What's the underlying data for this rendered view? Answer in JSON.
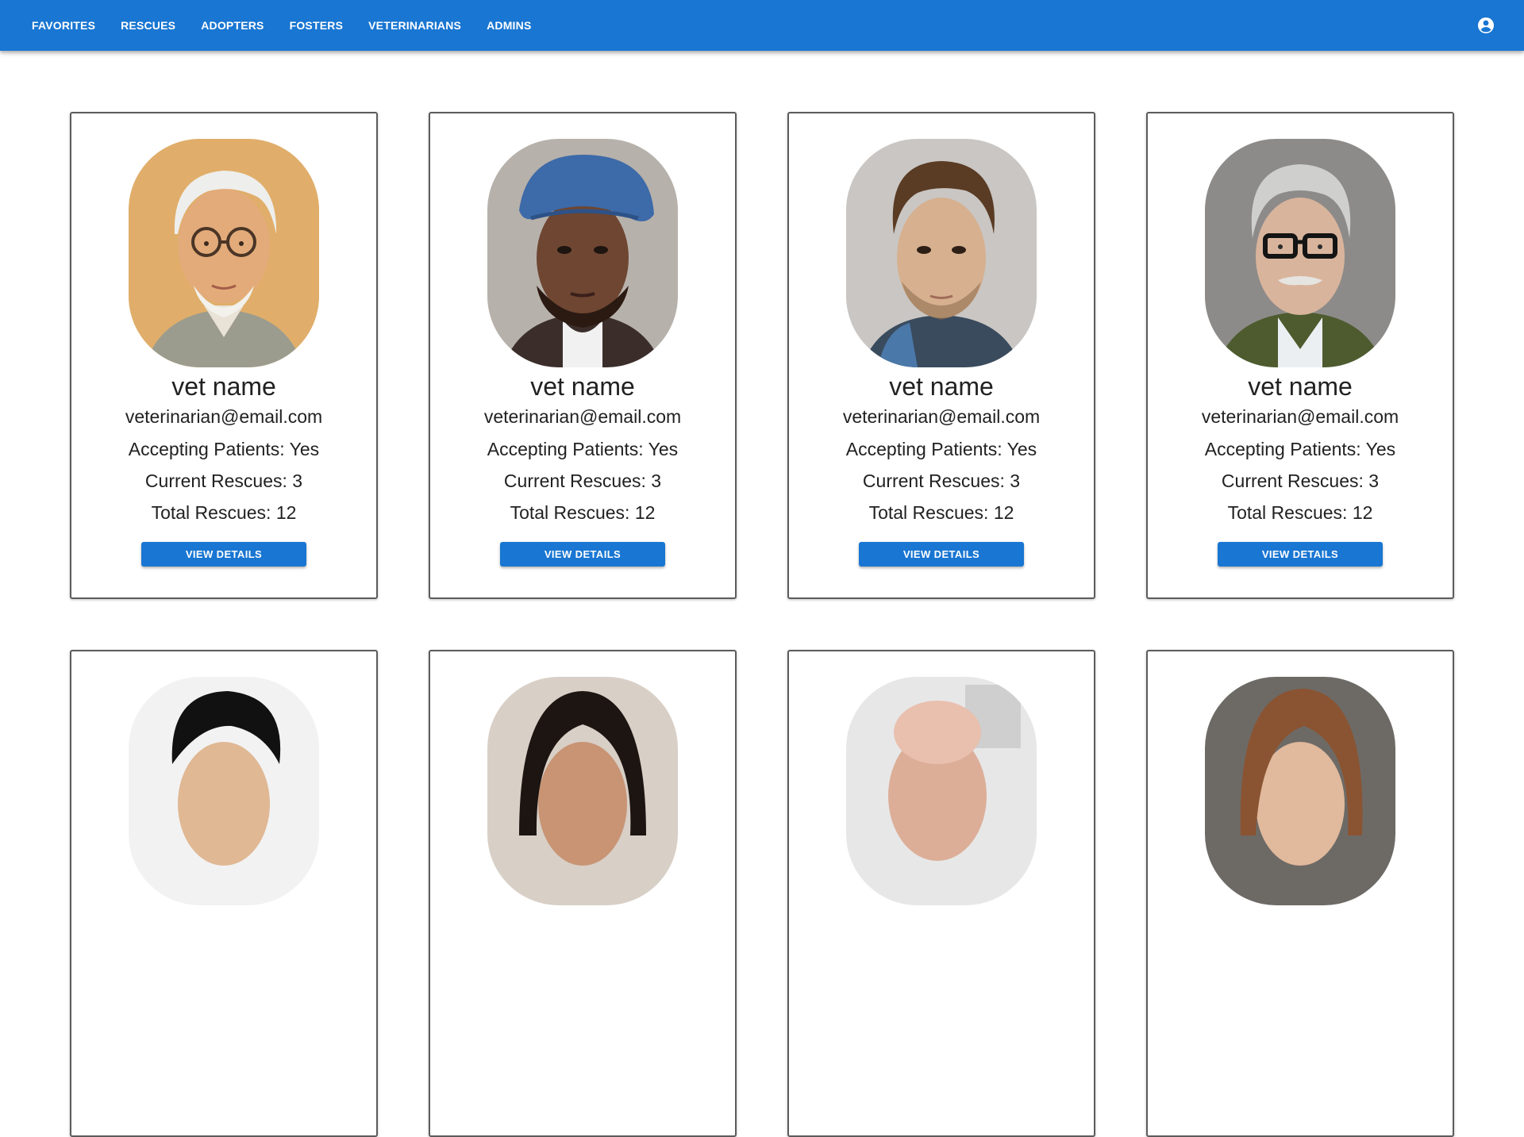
{
  "nav": {
    "items": [
      "FAVORITES",
      "RESCUES",
      "ADOPTERS",
      "FOSTERS",
      "VETERINARIANS",
      "ADMINS"
    ],
    "account_icon": "account-circle-icon"
  },
  "colors": {
    "primary": "#1976d2",
    "card_border": "#5c5c5c"
  },
  "vets": [
    {
      "name": "vet name",
      "email": "veterinarian@email.com",
      "accepting": "Accepting Patients: Yes",
      "current": "Current Rescues: 3",
      "total": "Total Rescues: 12",
      "button": "VIEW DETAILS",
      "portrait": "elderly-man-glasses-white-beard"
    },
    {
      "name": "vet name",
      "email": "veterinarian@email.com",
      "accepting": "Accepting Patients: Yes",
      "current": "Current Rescues: 3",
      "total": "Total Rescues: 12",
      "button": "VIEW DETAILS",
      "portrait": "man-blue-cap-beard"
    },
    {
      "name": "vet name",
      "email": "veterinarian@email.com",
      "accepting": "Accepting Patients: Yes",
      "current": "Current Rescues: 3",
      "total": "Total Rescues: 12",
      "button": "VIEW DETAILS",
      "portrait": "young-man-brown-hair"
    },
    {
      "name": "vet name",
      "email": "veterinarian@email.com",
      "accepting": "Accepting Patients: Yes",
      "current": "Current Rescues: 3",
      "total": "Total Rescues: 12",
      "button": "VIEW DETAILS",
      "portrait": "older-man-black-glasses"
    },
    {
      "portrait": "man-black-hair"
    },
    {
      "portrait": "woman-dark-hair"
    },
    {
      "portrait": "bald-man"
    },
    {
      "portrait": "woman-auburn-hair"
    }
  ]
}
